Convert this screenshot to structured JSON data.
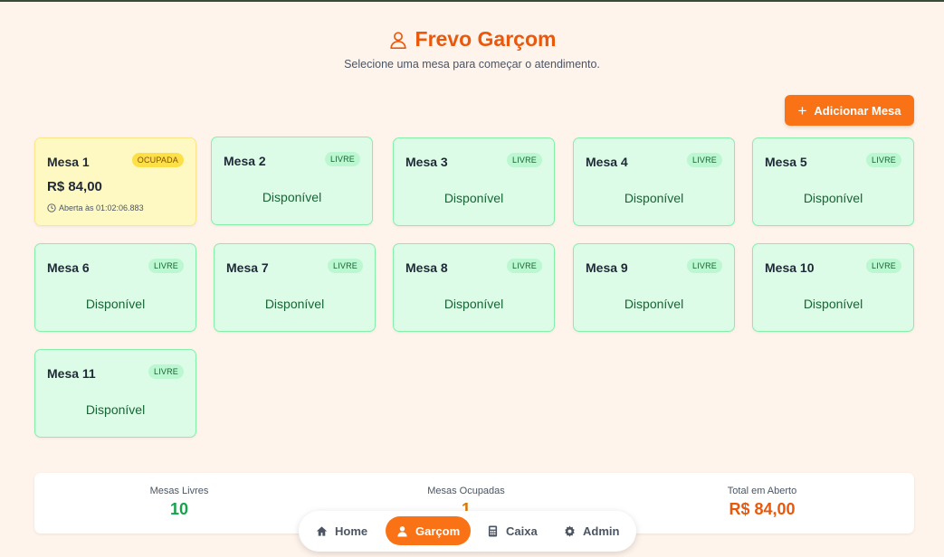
{
  "app": {
    "title": "Frevo Garçom",
    "subtitle": "Selecione uma mesa para começar o atendimento.",
    "add_button_label": "Adicionar Mesa"
  },
  "tables": [
    {
      "name": "Mesa 1",
      "badge": "OCUPADA",
      "status": "occupied",
      "amount": "R$ 84,00",
      "opened": "Aberta às 01:02:06.883"
    },
    {
      "name": "Mesa 2",
      "badge": "LIVRE",
      "status": "free",
      "text": "Disponível"
    },
    {
      "name": "Mesa 3",
      "badge": "LIVRE",
      "status": "free",
      "text": "Disponível"
    },
    {
      "name": "Mesa 4",
      "badge": "LIVRE",
      "status": "free",
      "text": "Disponível"
    },
    {
      "name": "Mesa 5",
      "badge": "LIVRE",
      "status": "free",
      "text": "Disponível"
    },
    {
      "name": "Mesa 6",
      "badge": "LIVRE",
      "status": "free",
      "text": "Disponível"
    },
    {
      "name": "Mesa 7",
      "badge": "LIVRE",
      "status": "free",
      "text": "Disponível"
    },
    {
      "name": "Mesa 8",
      "badge": "LIVRE",
      "status": "free",
      "text": "Disponível"
    },
    {
      "name": "Mesa 9",
      "badge": "LIVRE",
      "status": "free",
      "text": "Disponível"
    },
    {
      "name": "Mesa 10",
      "badge": "LIVRE",
      "status": "free",
      "text": "Disponível"
    },
    {
      "name": "Mesa 11",
      "badge": "LIVRE",
      "status": "free",
      "text": "Disponível"
    }
  ],
  "stats": {
    "free_label": "Mesas Livres",
    "free_value": "10",
    "occupied_label": "Mesas Ocupadas",
    "occupied_value": "1",
    "total_label": "Total em Aberto",
    "total_value": "R$ 84,00"
  },
  "nav": [
    {
      "label": "Home",
      "icon": "home-icon"
    },
    {
      "label": "Garçom",
      "icon": "user-icon",
      "active": true
    },
    {
      "label": "Caixa",
      "icon": "calculator-icon"
    },
    {
      "label": "Admin",
      "icon": "gear-icon"
    }
  ],
  "colors": {
    "accent": "#f97316",
    "title": "#ea580c",
    "free": "#16a34a",
    "occupied": "#d97706",
    "background": "#fef4ec"
  }
}
